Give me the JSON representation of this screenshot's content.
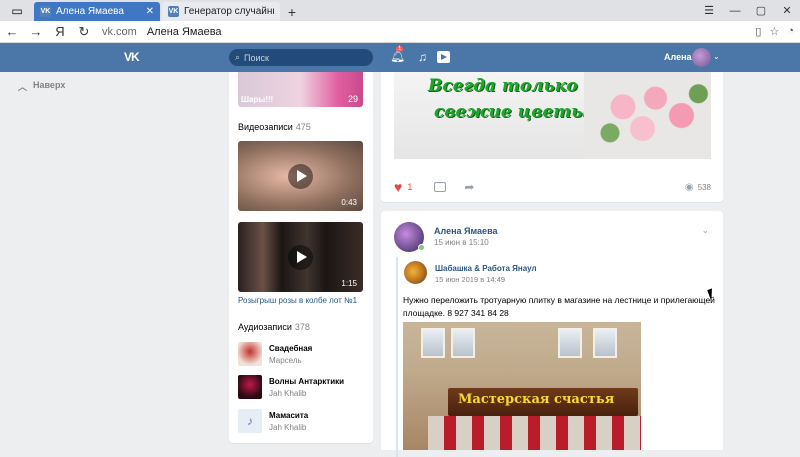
{
  "browser": {
    "tabs": [
      {
        "label": "Алена Ямаева",
        "favicon": "VK",
        "active": true
      },
      {
        "label": "Генератор случайных чисел",
        "favicon": "VK",
        "active": false
      }
    ],
    "new_tab": "+",
    "address": {
      "domain": "vk.com",
      "page_title": "Алена Ямаева"
    }
  },
  "header": {
    "logo": "VK",
    "search_placeholder": "Поиск",
    "notifications_count": "1",
    "user_name": "Алена"
  },
  "left_nav": {
    "back_label": "Наверх"
  },
  "profile_column": {
    "photo_caption": "Шары!!!",
    "photo_count": "29",
    "videos_title": "Видеозаписи",
    "videos_count": "475",
    "videos": [
      {
        "duration": "0:43"
      },
      {
        "duration": "1:15"
      }
    ],
    "video_link": "Розыгрыш розы в колбе лот №1",
    "audio_title": "Аудиозаписи",
    "audio_count": "378",
    "tracks": [
      {
        "title": "Свадебная",
        "artist": "Марсель"
      },
      {
        "title": "Волны Антарктики",
        "artist": "Jah Khalib"
      },
      {
        "title": "Мамасита",
        "artist": "Jah Khalib"
      }
    ]
  },
  "post1": {
    "banner_line1": "Всегда только",
    "banner_line2": "свежие цветы",
    "likes": "1",
    "views": "538"
  },
  "post2": {
    "author": "Алена Ямаева",
    "date": "15 июн в 15:10",
    "repost_author": "Шабашка & Работа Янаул",
    "repost_date": "15 июн 2019 в 14:49",
    "text": "Нужно переложить тротуарную плитку в магазине на лестнице и прилегающей площадке. 8 927 341 84 28",
    "photo_sign": "Мастерская счастья"
  }
}
